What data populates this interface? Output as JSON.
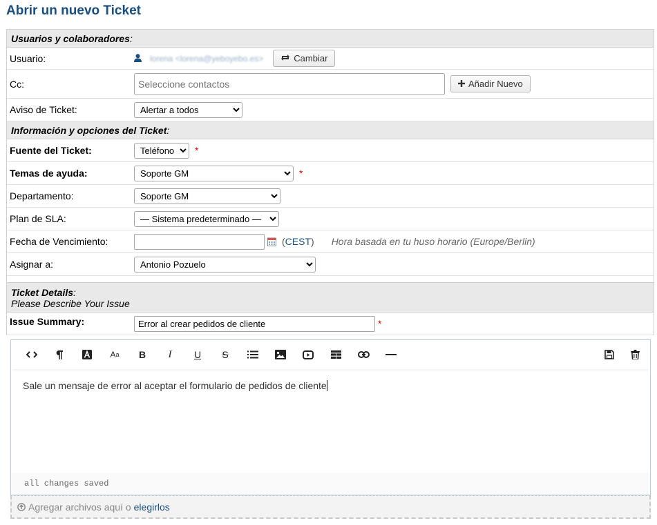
{
  "page": {
    "title": "Abrir un nuevo Ticket"
  },
  "sections": {
    "users": "Usuarios y colaboradores",
    "info": "Información y opciones del Ticket",
    "details_title": "Ticket Details",
    "details_sub": "Please Describe Your Issue"
  },
  "user": {
    "label": "Usuario:",
    "value": "lorena <lorena@yeboyebo.es>",
    "change_button": "Cambiar"
  },
  "cc": {
    "label": "Cc:",
    "placeholder": "Seleccione contactos",
    "add_button": "Añadir Nuevo"
  },
  "alert": {
    "label": "Aviso de Ticket:",
    "selected": "Alertar a todos"
  },
  "source": {
    "label": "Fuente del Ticket:",
    "selected": "Teléfono"
  },
  "help_topic": {
    "label": "Temas de ayuda:",
    "selected": "Soporte GM"
  },
  "department": {
    "label": "Departamento:",
    "selected": "Soporte GM"
  },
  "sla": {
    "label": "Plan de SLA:",
    "selected": "— Sistema predeterminado —"
  },
  "due_date": {
    "label": "Fecha de Vencimiento:",
    "value": "",
    "timezone": "CEST",
    "note": "Hora basada en tu huso horario (Europe/Berlin)"
  },
  "assign": {
    "label": "Asignar a:",
    "selected": "Antonio Pozuelo"
  },
  "summary": {
    "label": "Issue Summary:",
    "value": "Error al crear pedidos de cliente"
  },
  "editor": {
    "body": "Sale un mensaje de error al aceptar el formulario de pedidos de cliente",
    "status": "all changes saved"
  },
  "attachments": {
    "text": "Agregar archivos aquí o",
    "link": "elegirlos"
  },
  "required_mark": "*",
  "colors": {
    "title": "#184e81",
    "section_bg": "#e9e9e9",
    "required": "#ee0000"
  }
}
